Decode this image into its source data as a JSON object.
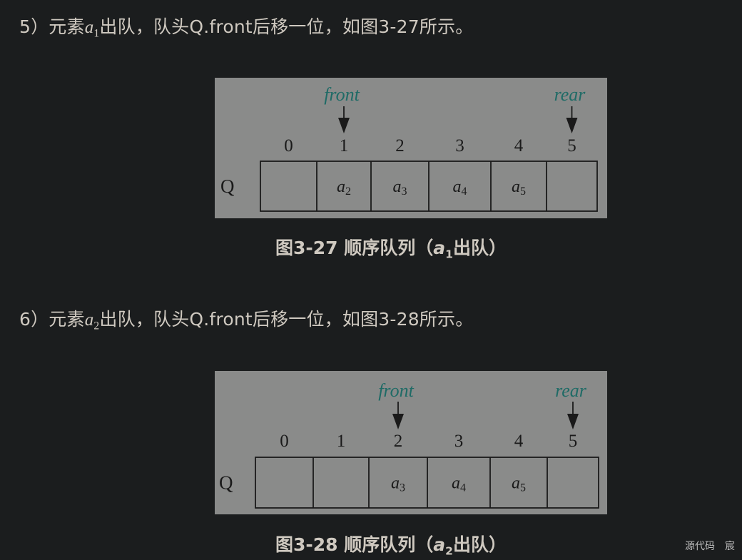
{
  "para5": {
    "prefix": "5）元素",
    "var": "a",
    "sub": "1",
    "suffix": "出队，队头Q.front后移一位，如图3-27所示。"
  },
  "fig27": {
    "queue_label": "Q",
    "front_label": "front",
    "rear_label": "rear",
    "front_index": 1,
    "rear_index": 5,
    "indices": [
      "0",
      "1",
      "2",
      "3",
      "4",
      "5"
    ],
    "cells": [
      {
        "var": "",
        "sub": ""
      },
      {
        "var": "a",
        "sub": "2"
      },
      {
        "var": "a",
        "sub": "3"
      },
      {
        "var": "a",
        "sub": "4"
      },
      {
        "var": "a",
        "sub": "5"
      },
      {
        "var": "",
        "sub": ""
      }
    ],
    "caption": {
      "prefix": "图3-27 顺序队列（",
      "var": "a",
      "sub": "1",
      "suffix": "出队）"
    }
  },
  "para6": {
    "prefix": "6）元素",
    "var": "a",
    "sub": "2",
    "suffix": "出队，队头Q.front后移一位，如图3-28所示。"
  },
  "fig28": {
    "queue_label": "Q",
    "front_label": "front",
    "rear_label": "rear",
    "front_index": 2,
    "rear_index": 5,
    "indices": [
      "0",
      "1",
      "2",
      "3",
      "4",
      "5"
    ],
    "cells": [
      {
        "var": "",
        "sub": ""
      },
      {
        "var": "",
        "sub": ""
      },
      {
        "var": "a",
        "sub": "3"
      },
      {
        "var": "a",
        "sub": "4"
      },
      {
        "var": "a",
        "sub": "5"
      },
      {
        "var": "",
        "sub": ""
      }
    ],
    "caption": {
      "prefix": "图3-28 顺序队列（",
      "var": "a",
      "sub": "2",
      "suffix": "出队）"
    }
  },
  "colors": {
    "label": "#1f6b66",
    "ink": "#1a1a1a",
    "figure_bg": "#8a8b8a"
  },
  "watermark": "源代码　宸"
}
